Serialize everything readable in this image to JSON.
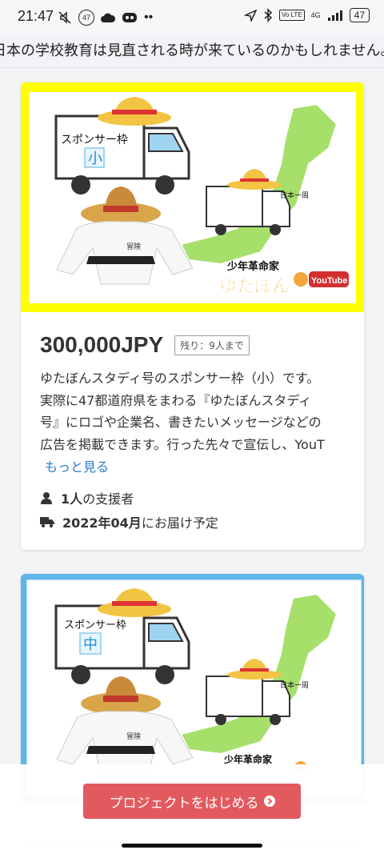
{
  "status_bar": {
    "time": "21:47",
    "notif_count": "47",
    "net": "4G",
    "battery": "47"
  },
  "marquee": {
    "text": "日本の学校教育は見直される時が来ているのかもしれません。"
  },
  "cards": [
    {
      "banner": {
        "sign": "スポンサー枠",
        "size_char": "小",
        "truck_label": "日本一周",
        "tag1": "少年革命家",
        "tag2": "ゆたぼん",
        "yt": "YouTube",
        "shirt": "冒険"
      },
      "price": "300,000JPY",
      "remaining": "残り：9人まで",
      "desc_lines": [
        "ゆたぼんスタディ号のスポンサー枠（小）です。",
        "実際に47都道府県をまわる『ゆたぼんスタディ",
        "号』にロゴや企業名、書きたいメッセージなどの",
        "広告を掲載できます。行った先々で宣伝し、YouT"
      ],
      "more": "もっと見る",
      "supporters_count": "1人",
      "supporters_suffix": "の支援者",
      "delivery_date": "2022年04月",
      "delivery_suffix": "にお届け予定"
    },
    {
      "banner": {
        "sign": "スポンサー枠",
        "size_char": "中",
        "truck_label": "日本一周",
        "tag1": "少年革命家",
        "shirt": "冒険"
      }
    }
  ],
  "cta": {
    "label": "プロジェクトをはじめる"
  },
  "colors": {
    "accent": "#e35a5e",
    "link": "#2a7ad0",
    "card1_frame": "#ffff00",
    "card2_frame": "#5fb5e8"
  }
}
